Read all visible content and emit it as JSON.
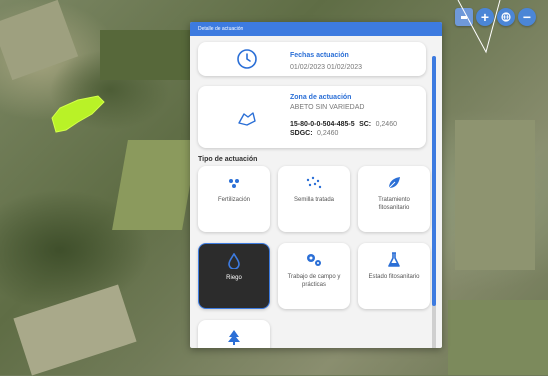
{
  "panel": {
    "title": "Detalle de actuación",
    "dates": {
      "title": "Fechas actuación",
      "value": "01/02/2023 01/02/2023"
    },
    "zone": {
      "title": "Zona de actuación",
      "variety": "ABETO SIN VARIEDAD",
      "parcel_code": "15-80-0-0-504-485-5",
      "sc_label": "SC:",
      "sc_value": "0,2460",
      "sdgc_label": "SDGC:",
      "sdgc_value": "0,2460"
    },
    "section_title": "Tipo de actuación",
    "tiles": [
      {
        "label": "Fertilización",
        "icon": "fertilizer-drops-icon",
        "selected": false
      },
      {
        "label": "Semilla tratada",
        "icon": "seeds-icon",
        "selected": false
      },
      {
        "label": "Tratamiento fitosanitario",
        "icon": "leaf-icon",
        "selected": false
      },
      {
        "label": "Riego",
        "icon": "water-drop-icon",
        "selected": true
      },
      {
        "label": "Trabajo de campo y prácticas",
        "icon": "gears-icon",
        "selected": false
      },
      {
        "label": "Estado fitosanitario",
        "icon": "flask-icon",
        "selected": false
      },
      {
        "label": "",
        "icon": "tree-icon",
        "selected": false
      }
    ]
  },
  "map_controls": {
    "zoom_in": "+",
    "zoom_out": "−"
  },
  "colors": {
    "accent": "#3d7be0",
    "parcel_highlight": "#b9f227"
  }
}
